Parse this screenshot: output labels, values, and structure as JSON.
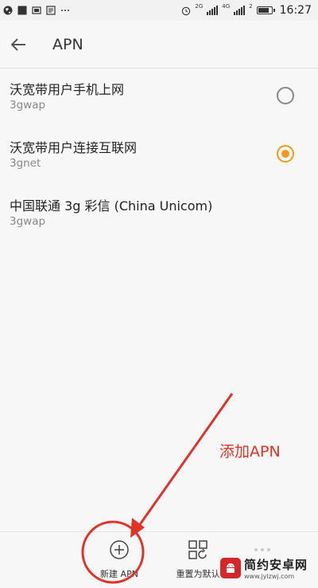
{
  "status_bar": {
    "time": "16:27",
    "network_tags": [
      "2G",
      "4G",
      "2"
    ],
    "battery_level": 0.85,
    "icons": [
      "globe-icon",
      "square-icon",
      "mail-icon",
      "image-icon",
      "more-icon",
      "alarm-icon",
      "signal-icon",
      "battery-icon"
    ]
  },
  "app_bar": {
    "title": "APN",
    "back_icon": "arrow-left-icon"
  },
  "apn_list": [
    {
      "name": "沃宽带用户手机上网",
      "type": "3gwap",
      "selected": false
    },
    {
      "name": "沃宽带用户连接互联网",
      "type": "3gnet",
      "selected": true
    },
    {
      "name": "中国联通 3g 彩信 (China Unicom)",
      "type": "3gwap",
      "selected": null
    }
  ],
  "bottom_bar": {
    "add_label": "新建 APN",
    "reset_label": "重置为默认",
    "add_icon": "plus-circle-icon",
    "reset_icon": "grid-refresh-icon",
    "more_icon": "more-icon"
  },
  "annotation": {
    "text": "添加APN",
    "color": "#e03328"
  },
  "watermark": {
    "title": "简约安卓网",
    "url": "www.jylzwj.com",
    "logo_icon": "android-icon"
  },
  "colors": {
    "accent": "#f39a1e",
    "annotation": "#e03328"
  }
}
